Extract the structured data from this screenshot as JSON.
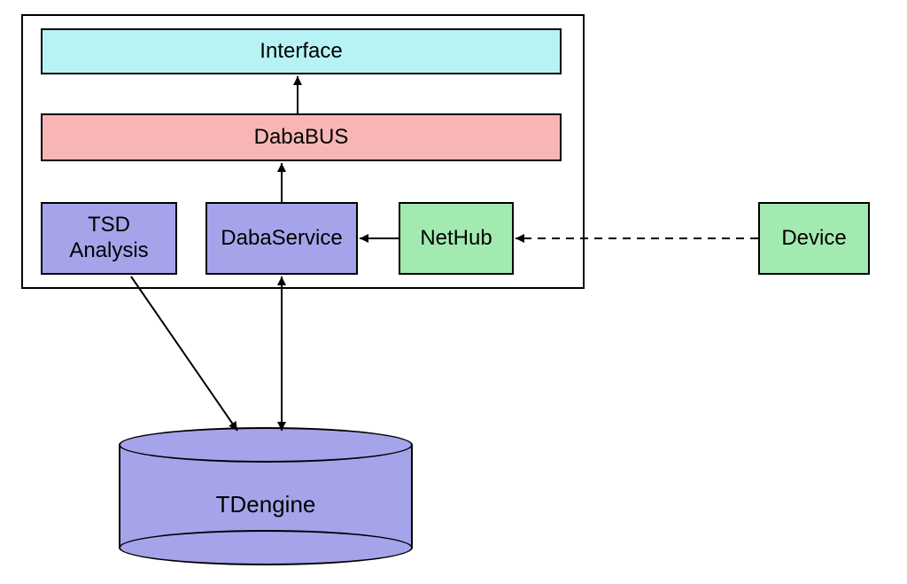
{
  "diagram": {
    "container": {},
    "blocks": {
      "interface": {
        "label": "Interface",
        "fill": "#b7f3f5"
      },
      "dababus": {
        "label": "DabaBUS",
        "fill": "#f7b6b5"
      },
      "tsd": {
        "label": "TSD\nAnalysis",
        "fill": "#a5a4ea"
      },
      "dabaservice": {
        "label": "DabaService",
        "fill": "#a5a4ea"
      },
      "nethub": {
        "label": "NetHub",
        "fill": "#a3eab0"
      },
      "device": {
        "label": "Device",
        "fill": "#a3eab0"
      }
    },
    "cylinder": {
      "tdengine": {
        "label": "TDengine",
        "fill": "#a5a4ea"
      }
    },
    "arrows": [
      {
        "name": "dababus-to-interface",
        "from": "dababus",
        "to": "interface",
        "type": "solid",
        "heads": "end"
      },
      {
        "name": "dabaservice-to-dababus",
        "from": "dabaservice",
        "to": "dababus",
        "type": "solid",
        "heads": "end"
      },
      {
        "name": "nethub-to-dabaservice",
        "from": "nethub",
        "to": "dabaservice",
        "type": "solid",
        "heads": "end"
      },
      {
        "name": "device-to-nethub",
        "from": "device",
        "to": "nethub",
        "type": "dashed",
        "heads": "end"
      },
      {
        "name": "tsd-to-tdengine",
        "from": "tsd",
        "to": "tdengine",
        "type": "solid",
        "heads": "end"
      },
      {
        "name": "dabaservice-tdengine",
        "from": "dabaservice",
        "to": "tdengine",
        "type": "solid",
        "heads": "both"
      }
    ]
  }
}
